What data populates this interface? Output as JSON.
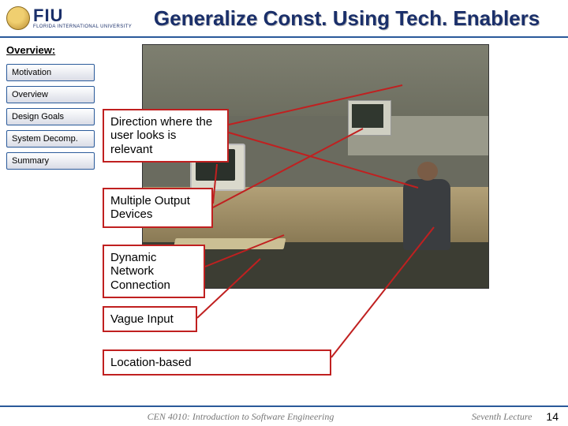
{
  "header": {
    "logo_text": "FIU",
    "logo_sub": "FLORIDA INTERNATIONAL UNIVERSITY",
    "title": "Generalize Const. Using Tech. Enablers"
  },
  "sidebar": {
    "section": "Overview:",
    "items": [
      {
        "label": "Motivation"
      },
      {
        "label": "Overview"
      },
      {
        "label": "Design Goals"
      },
      {
        "label": "System Decomp."
      },
      {
        "label": "Summary"
      }
    ]
  },
  "callouts": {
    "c1": "Direction where the user looks is relevant",
    "c2": "Multiple Output Devices",
    "c3": "Dynamic Network Connection",
    "c4": "Vague Input",
    "c5": "Location-based"
  },
  "footer": {
    "course": "CEN 4010: Introduction to Software Engineering",
    "lecture": "Seventh Lecture",
    "page": "14"
  }
}
